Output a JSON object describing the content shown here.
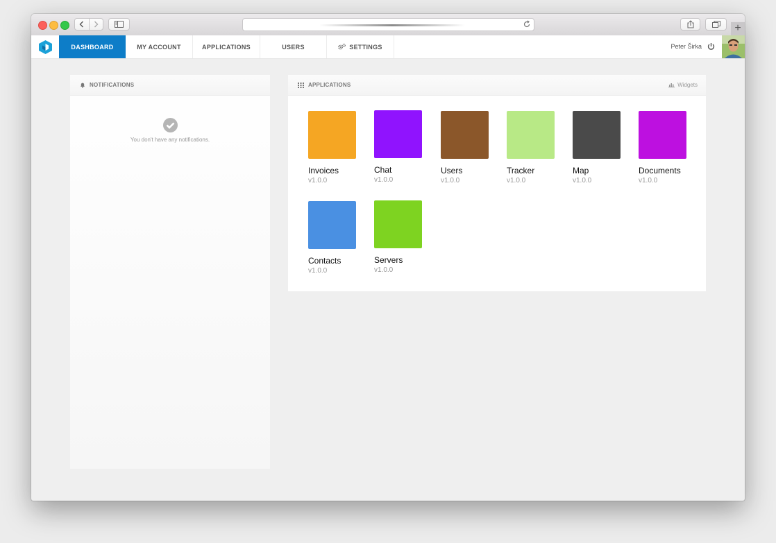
{
  "topnav": {
    "items": [
      {
        "label": "DASHBOARD",
        "active": true
      },
      {
        "label": "MY ACCOUNT"
      },
      {
        "label": "APPLICATIONS"
      },
      {
        "label": "USERS"
      },
      {
        "label": "SETTINGS",
        "icon": "gears-icon"
      }
    ],
    "user_name": "Peter Širka"
  },
  "notifications": {
    "title": "NOTIFICATIONS",
    "empty_message": "You don't have any notifications."
  },
  "applications": {
    "title": "APPLICATIONS",
    "widgets_label": "Widgets",
    "apps": [
      {
        "name": "Invoices",
        "version": "v1.0.0",
        "color": "#f5a623"
      },
      {
        "name": "Chat",
        "version": "v1.0.0",
        "color": "#9013fe"
      },
      {
        "name": "Users",
        "version": "v1.0.0",
        "color": "#8b572a"
      },
      {
        "name": "Tracker",
        "version": "v1.0.0",
        "color": "#b8e986"
      },
      {
        "name": "Map",
        "version": "v1.0.0",
        "color": "#4a4a4a"
      },
      {
        "name": "Documents",
        "version": "v1.0.0",
        "color": "#bd10e0"
      },
      {
        "name": "Contacts",
        "version": "v1.0.0",
        "color": "#4a90e2"
      },
      {
        "name": "Servers",
        "version": "v1.0.0",
        "color": "#7ed321"
      }
    ]
  },
  "colors": {
    "accent": "#0d7dc8"
  }
}
